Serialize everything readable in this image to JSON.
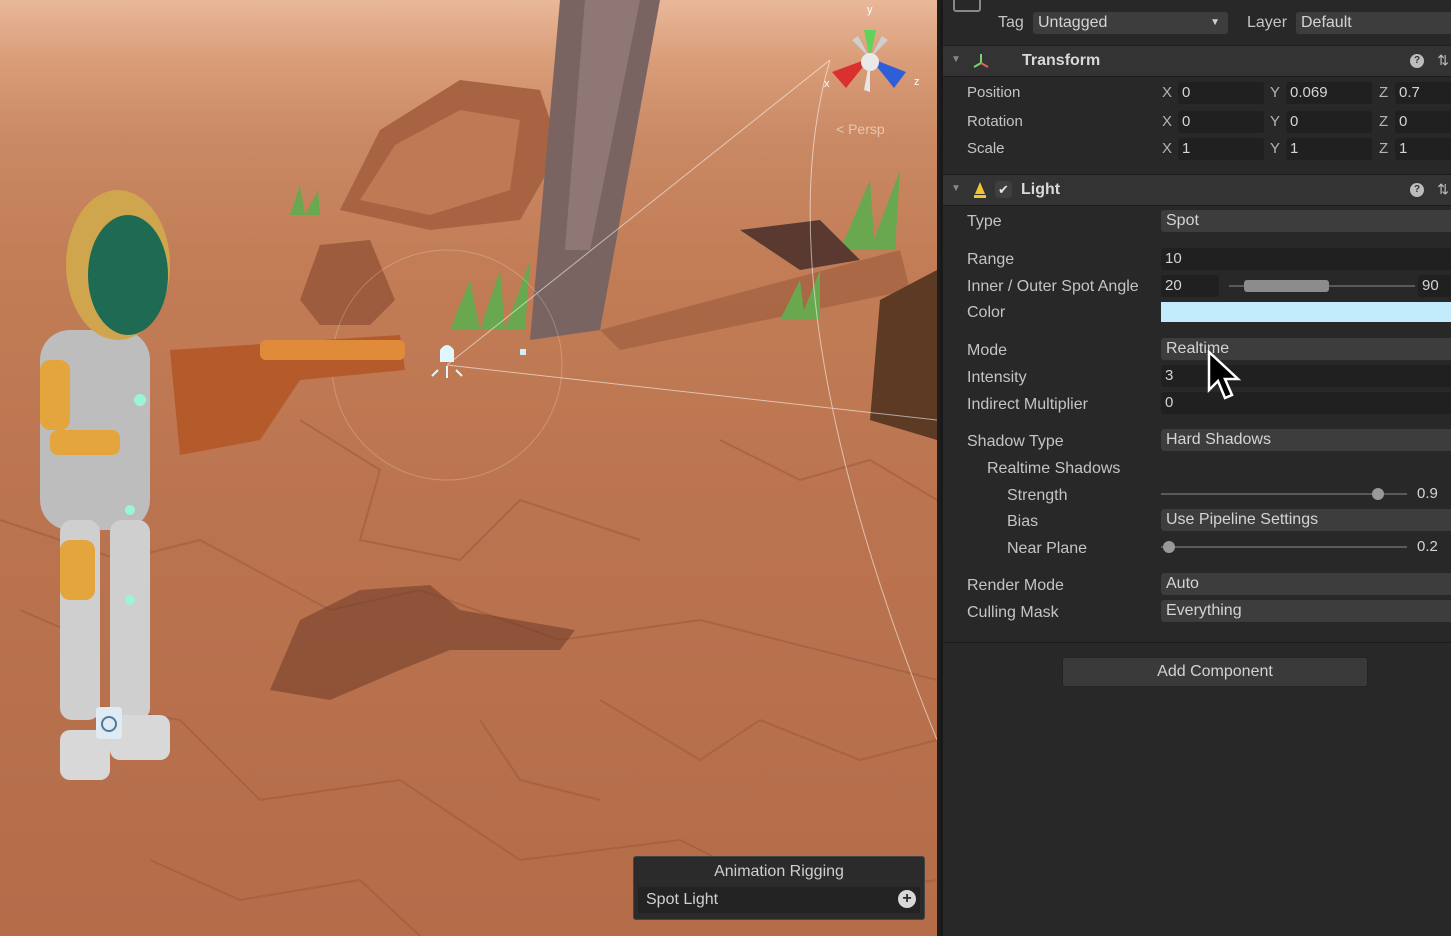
{
  "scene": {
    "gizmo": {
      "y": "y",
      "x": "x",
      "z": "z",
      "persp": "< Persp"
    },
    "overlay": {
      "title": "Animation Rigging",
      "item": "Spot Light"
    }
  },
  "inspector": {
    "tag_label": "Tag",
    "tag_value": "Untagged",
    "layer_label": "Layer",
    "layer_value": "Default",
    "transform": {
      "title": "Transform",
      "rows": [
        {
          "label": "Position",
          "x": "0",
          "y": "0.069",
          "z": "0.7"
        },
        {
          "label": "Rotation",
          "x": "0",
          "y": "0",
          "z": "0"
        },
        {
          "label": "Scale",
          "x": "1",
          "y": "1",
          "z": "1"
        }
      ],
      "axis_x": "X",
      "axis_y": "Y",
      "axis_z": "Z"
    },
    "light": {
      "title": "Light",
      "enabled": true,
      "type_label": "Type",
      "type_value": "Spot",
      "range_label": "Range",
      "range_value": "10",
      "angle_label": "Inner / Outer Spot Angle",
      "angle_inner": "20",
      "angle_outer": "90",
      "color_label": "Color",
      "color_value": "#c2ecfb",
      "mode_label": "Mode",
      "mode_value": "Realtime",
      "intensity_label": "Intensity",
      "intensity_value": "3",
      "indirect_label": "Indirect Multiplier",
      "indirect_value": "0",
      "shadow_type_label": "Shadow Type",
      "shadow_type_value": "Hard Shadows",
      "realtime_shadows_label": "Realtime Shadows",
      "strength_label": "Strength",
      "strength_value": "0.9",
      "strength_fraction": 0.9,
      "bias_label": "Bias",
      "bias_value": "Use Pipeline Settings",
      "near_plane_label": "Near Plane",
      "near_plane_value": "0.2",
      "near_plane_fraction": 0.0,
      "render_mode_label": "Render Mode",
      "render_mode_value": "Auto",
      "culling_label": "Culling Mask",
      "culling_value": "Everything"
    },
    "add_component": "Add Component"
  }
}
